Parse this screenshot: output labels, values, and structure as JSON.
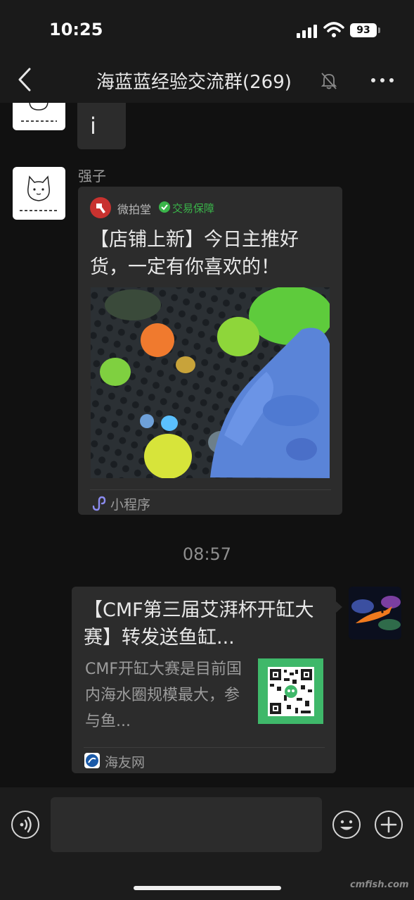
{
  "status_bar": {
    "time": "10:25",
    "battery": "93"
  },
  "nav": {
    "title": "海蓝蓝经验交流群(269)"
  },
  "chat": {
    "prev_message_text": "i",
    "sender_name": "强子",
    "mini_program_card": {
      "source": "微拍堂",
      "guarantee_badge": "交易保障",
      "title": "【店铺上新】今日主推好货，一定有你喜欢的！",
      "footer": "小程序"
    },
    "time_divider": "08:57",
    "link_card": {
      "title": "【CMF第三届艾湃杯开缸大赛】转发送鱼缸...",
      "description": "CMF开缸大赛是目前国内海水圈规模最大，参与鱼...",
      "footer": "海友网"
    }
  },
  "watermark": "cmfish.com",
  "colors": {
    "background": "#111111",
    "bubble": "#2c2c2c",
    "accent_green": "#3ab54a",
    "brand_red": "#c8322f"
  }
}
